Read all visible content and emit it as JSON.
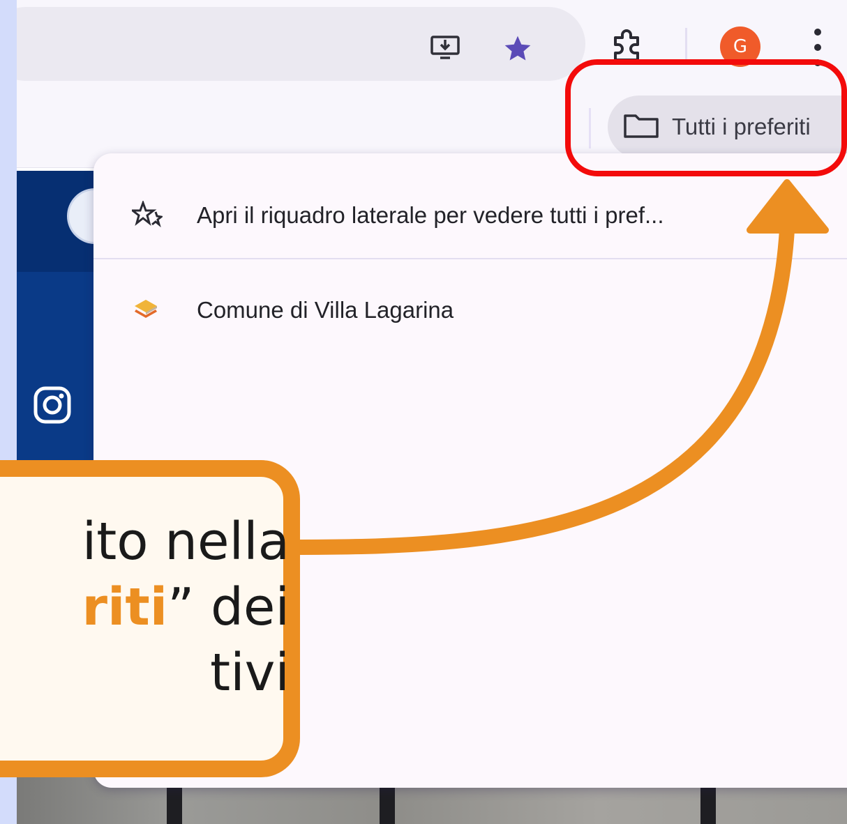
{
  "browser": {
    "toolbar": {
      "install_icon": "install-app-icon",
      "bookmark_star_icon": "star-icon",
      "extensions_icon": "puzzle-icon",
      "profile_initial": "G",
      "menu_icon": "kebab-menu-icon"
    },
    "bookmarks_bar": {
      "all_bookmarks_label": "Tutti i preferiti",
      "folder_icon": "folder-icon"
    },
    "dropdown": {
      "items": [
        {
          "icon": "sparkle-star-icon",
          "label": "Apri il riquadro laterale per vedere tutti i pref..."
        },
        {
          "icon": "layers-favicon-icon",
          "label": "Comune di Villa Lagarina"
        }
      ]
    }
  },
  "callout": {
    "line1": "ito nella",
    "line2_highlight": "riti",
    "line2_rest": "” dei",
    "line3": "tivi"
  },
  "colors": {
    "page_bg": "#d3dcfb",
    "accent_orange": "#ec8f22",
    "highlight_red": "#f30b0b",
    "star_purple": "#5b4bb7",
    "avatar_orange": "#f05b2a",
    "site_navy": "#0a3a87"
  }
}
